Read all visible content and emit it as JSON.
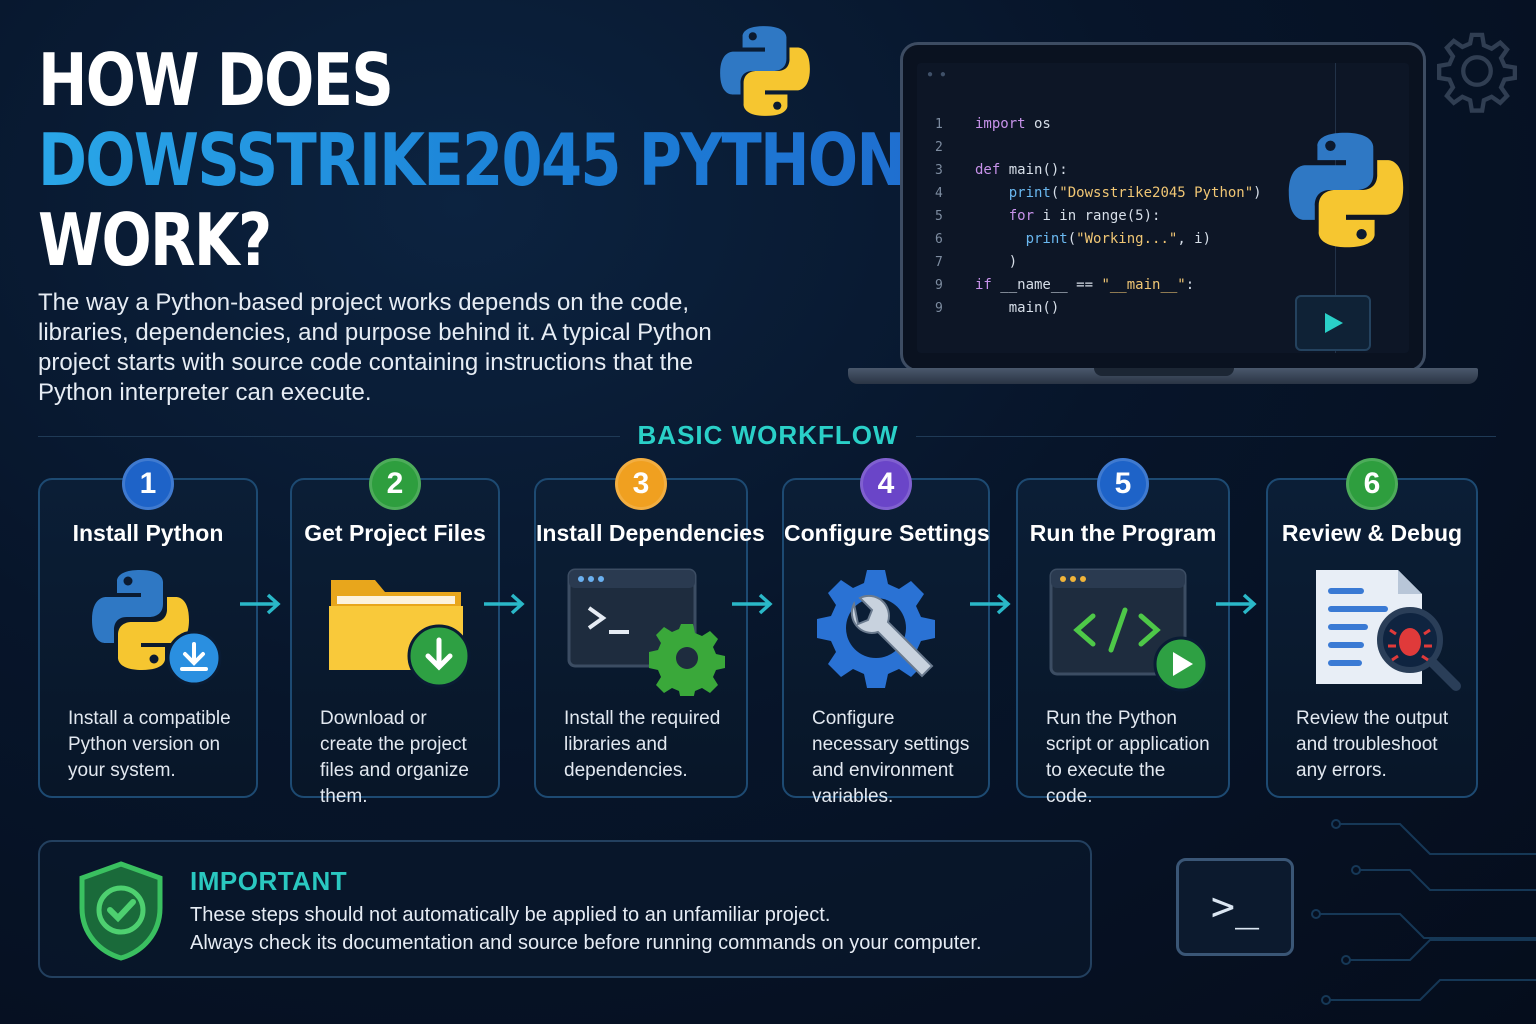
{
  "header": {
    "title_line1": "HOW DOES",
    "title_line2": "DOWSSTRIKE2045 PYTHON",
    "title_line3": "WORK?",
    "intro": "The way a Python-based project works depends on the code, libraries, dependencies, and purpose behind it. A typical Python project starts with source code containing instructions that the Python interpreter can execute."
  },
  "code_editor": {
    "line_numbers": [
      "1",
      "2",
      "3",
      "4",
      "5",
      "6",
      "7",
      "9",
      "9"
    ],
    "lines": [
      {
        "kw": "import",
        "rest": " os"
      },
      {
        "kw": "",
        "rest": ""
      },
      {
        "kw": "def",
        "rest": " main():"
      },
      {
        "kw": "    print",
        "rest": "(\"Dowsstrike2045 Python\")"
      },
      {
        "kw": "    for",
        "rest": " i in range(5):"
      },
      {
        "kw": "      print",
        "rest": "(\"Working...\", i)"
      },
      {
        "kw": "",
        "rest": "    )"
      },
      {
        "kw": "if",
        "rest": " __name__ == \"__main__\":"
      },
      {
        "kw": "",
        "rest": "    main()"
      }
    ]
  },
  "workflow": {
    "title": "BASIC WORKFLOW",
    "steps": [
      {
        "number": "1",
        "title": "Install Python",
        "desc": "Install a compatible Python version on your system.",
        "color": "#1e63c8"
      },
      {
        "number": "2",
        "title": "Get Project Files",
        "desc": "Download or create the project files and organize them.",
        "color": "#2e9e3e"
      },
      {
        "number": "3",
        "title": "Install Dependencies",
        "desc": "Install the required libraries and dependencies.",
        "color": "#f0a020"
      },
      {
        "number": "4",
        "title": "Configure Settings",
        "desc": "Configure necessary settings and environment variables.",
        "color": "#6a45c8"
      },
      {
        "number": "5",
        "title": "Run the Program",
        "desc": "Run the Python script or application to execute the code.",
        "color": "#1e63c8"
      },
      {
        "number": "6",
        "title": "Review & Debug",
        "desc": "Review the output and troubleshoot any errors.",
        "color": "#2e9e3e"
      }
    ]
  },
  "important": {
    "title": "IMPORTANT",
    "line1": "These steps should not automatically be applied to an unfamiliar project.",
    "line2": "Always check its documentation and source before running commands on your computer."
  },
  "terminal_symbol": ">_",
  "icons": [
    "python-logo-icon",
    "gear-icon",
    "play-icon",
    "download-icon",
    "folder-icon",
    "terminal-icon",
    "code-icon",
    "wrench-gear-icon",
    "document-bug-icon",
    "shield-check-icon",
    "arrow-right-icon"
  ]
}
